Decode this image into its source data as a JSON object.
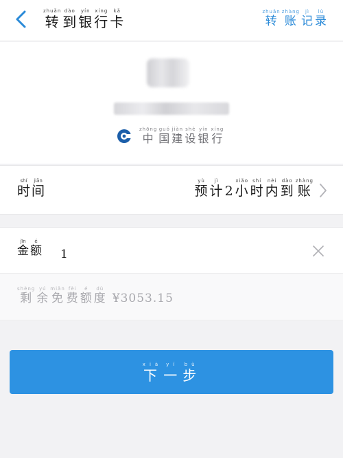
{
  "header": {
    "title": [
      {
        "py": "zhuǎn",
        "hz": "转"
      },
      {
        "py": "dào",
        "hz": "到"
      },
      {
        "py": "yín",
        "hz": "银"
      },
      {
        "py": "xíng",
        "hz": "行"
      },
      {
        "py": "kǎ",
        "hz": "卡"
      }
    ],
    "right_link": [
      {
        "py": "zhuǎn",
        "hz": "转"
      },
      {
        "py": "zhàng",
        "hz": "账"
      },
      {
        "py": "jì",
        "hz": "记"
      },
      {
        "py": "lù",
        "hz": "录"
      }
    ]
  },
  "recipient": {
    "bank_name": [
      {
        "py": "zhōng",
        "hz": "中"
      },
      {
        "py": "guó",
        "hz": "国"
      },
      {
        "py": "jiàn",
        "hz": "建"
      },
      {
        "py": "shè",
        "hz": "设"
      },
      {
        "py": "yín",
        "hz": "银"
      },
      {
        "py": "xíng",
        "hz": "行"
      }
    ],
    "bank_logo_color": "#1b5ea9",
    "name_masked": "",
    "account_masked": ""
  },
  "time_row": {
    "label": [
      {
        "py": "shí",
        "hz": "时"
      },
      {
        "py": "jiān",
        "hz": "间"
      }
    ],
    "value": [
      {
        "py": "yù",
        "hz": "预"
      },
      {
        "py": "jì",
        "hz": "计"
      },
      {
        "py": "",
        "hz": "2"
      },
      {
        "py": "xiǎo",
        "hz": "小"
      },
      {
        "py": "shí",
        "hz": "时"
      },
      {
        "py": "nèi",
        "hz": "内"
      },
      {
        "py": "dào",
        "hz": "到"
      },
      {
        "py": "zhàng",
        "hz": "账"
      }
    ]
  },
  "amount_row": {
    "label": [
      {
        "py": "jīn",
        "hz": "金"
      },
      {
        "py": "é",
        "hz": "额"
      }
    ],
    "value": "1"
  },
  "fee_row": {
    "label": [
      {
        "py": "shèng",
        "hz": "剩"
      },
      {
        "py": "yú",
        "hz": "余"
      },
      {
        "py": "miǎn",
        "hz": "免"
      },
      {
        "py": "fèi",
        "hz": "费"
      },
      {
        "py": "é",
        "hz": "额"
      },
      {
        "py": "dù",
        "hz": "度"
      }
    ],
    "amount": "¥3053.15"
  },
  "next_button": {
    "label": [
      {
        "py": "xià",
        "hz": "下"
      },
      {
        "py": "yí",
        "hz": "一"
      },
      {
        "py": "bù",
        "hz": "步"
      }
    ]
  },
  "colors": {
    "accent": "#2a8ad8",
    "button": "#2d92e2",
    "muted_text": "#a8a8ad"
  },
  "icons": {
    "back": "chevron-left-icon",
    "chevron": "chevron-right-icon",
    "clear": "close-icon",
    "bank_logo": "ccb-logo-icon"
  }
}
